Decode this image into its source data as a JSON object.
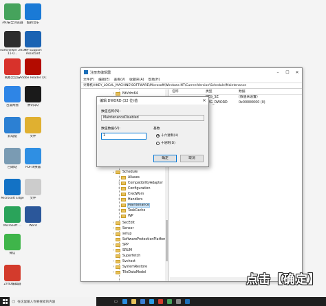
{
  "desktop": {
    "icons": [
      {
        "label": "360安全浏览器",
        "icon": "browser-e-icon",
        "color": "#46a35c"
      },
      {
        "label": "酷狗音乐",
        "icon": "kugou-icon",
        "color": "#1a7ad6"
      },
      {
        "label": "Teamviewer 2019 11-0...",
        "icon": "teamviewer-icon",
        "color": "#2d2d2d"
      },
      {
        "label": "HP Support Assistant",
        "icon": "hp-icon",
        "color": "#1a63b3"
      },
      {
        "label": "网易云音乐",
        "icon": "netease-music-icon",
        "color": "#d8322b"
      },
      {
        "label": "Adobe Reader DC",
        "icon": "adobe-reader-icon",
        "color": "#b30b00"
      },
      {
        "label": "百度网盘",
        "icon": "cloud-icon",
        "color": "#2e85e6"
      },
      {
        "label": "腾讯QQ",
        "icon": "qq-icon",
        "color": "#1a1a1a"
      },
      {
        "label": "此电脑",
        "icon": "computer-icon",
        "color": "#2c80d3"
      },
      {
        "label": "文件",
        "icon": "file-icon",
        "color": "#e0b030"
      },
      {
        "label": "回收站",
        "icon": "recycle-bin-icon",
        "color": "#7a9bb3"
      },
      {
        "label": "PDF转换器",
        "icon": "microphone-icon",
        "color": "#2f8fe3"
      },
      {
        "label": "Microsoft Edge",
        "icon": "edge-icon",
        "color": "#1372c5"
      },
      {
        "label": "文件",
        "icon": "document-icon",
        "color": "#cccccc"
      },
      {
        "label": "Microsoft ...",
        "icon": "app-icon",
        "color": "#2aa35a"
      },
      {
        "label": "Word",
        "icon": "word-icon",
        "color": "#2b579a"
      },
      {
        "label": "微信",
        "icon": "wechat-icon",
        "color": "#3fb54a"
      },
      {
        "label": "",
        "icon": "blank-icon",
        "color": "#f4f4f4"
      },
      {
        "label": "ZY40编辑器",
        "icon": "tool-icon",
        "color": "#d33b2c"
      }
    ]
  },
  "regedit": {
    "title": "注册表编辑器",
    "menu": [
      "文件(F)",
      "编辑(E)",
      "查看(V)",
      "收藏夹(A)",
      "帮助(H)"
    ],
    "address": "计算机\\HKEY_LOCAL_MACHINE\\SOFTWARE\\Microsoft\\Windows NT\\CurrentVersion\\Schedule\\Maintenance",
    "tree": {
      "top": [
        "NtVdm64"
      ],
      "schedule": "Schedule",
      "schedule_children": [
        "Aliases",
        "CompatibilityAdapter",
        "Configuration",
        "CredWom",
        "Handlers",
        "Maintenance",
        "TaskCache",
        "WP"
      ],
      "after": [
        "SecEdit",
        "Sensor",
        "setup",
        "SoftwareProtectionPlatform",
        "SPP",
        "SRUM",
        "Superfetch",
        "Svchost",
        "SystemRestore",
        "TileDataModel"
      ],
      "selected": "Maintenance"
    },
    "list": {
      "headers": [
        "名称",
        "类型",
        "数据"
      ],
      "rows": [
        {
          "name": "",
          "type": "REG_SZ",
          "data": "(数值未设置)"
        },
        {
          "name": "",
          "type": "REG_DWORD",
          "data": "0x00000000 (0)"
        }
      ]
    }
  },
  "dialog": {
    "title": "编辑 DWORD (32 位)值",
    "value_name_label": "数值名称(N):",
    "value_name": "MaintenanceDisabled",
    "value_data_label": "数值数据(V):",
    "value_data": "1",
    "base_label": "基数",
    "base_hex": "十六进制(H)",
    "base_dec": "十进制(D)",
    "ok": "确定",
    "cancel": "取消"
  },
  "caption": "点击【确定】",
  "taskbar": {
    "search_placeholder": "在这里输入你要搜索的内容"
  }
}
